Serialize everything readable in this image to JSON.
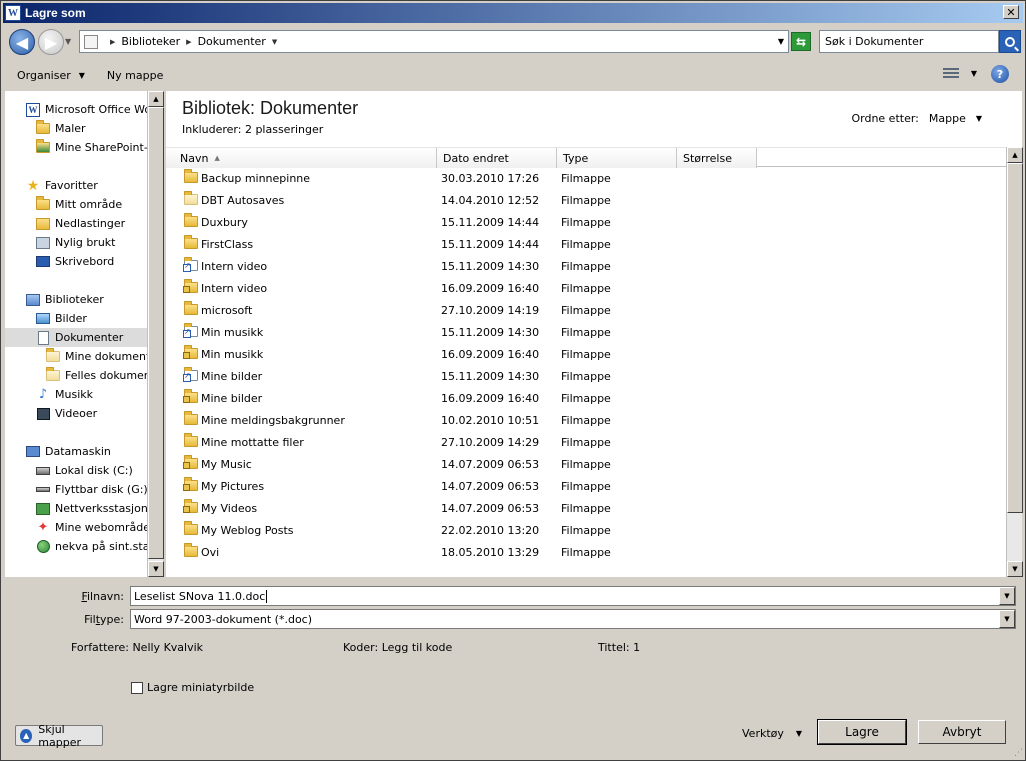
{
  "window": {
    "title": "Lagre som",
    "app_icon_letter": "W",
    "close_glyph": "✕"
  },
  "address": {
    "crumbs": [
      "Biblioteker",
      "Dokumenter"
    ],
    "search_placeholder": "Søk i Dokumenter"
  },
  "toolbar": {
    "organize_label": "Organiser",
    "new_folder_label": "Ny mappe",
    "help_glyph": "?"
  },
  "nav": {
    "items": [
      {
        "label": "Microsoft Office Word",
        "icon": "word-icon"
      },
      {
        "label": "Maler",
        "icon": "folder-icon"
      },
      {
        "label": "Mine SharePoint-om",
        "icon": "sharepoint-folder-icon"
      },
      {
        "label": "Favoritter",
        "icon": "star-icon"
      },
      {
        "label": "Mitt område",
        "icon": "my-site-icon"
      },
      {
        "label": "Nedlastinger",
        "icon": "downloads-icon"
      },
      {
        "label": "Nylig brukt",
        "icon": "recent-icon"
      },
      {
        "label": "Skrivebord",
        "icon": "desktop-icon"
      },
      {
        "label": "Biblioteker",
        "icon": "libraries-icon"
      },
      {
        "label": "Bilder",
        "icon": "pictures-icon"
      },
      {
        "label": "Dokumenter",
        "icon": "documents-icon"
      },
      {
        "label": "Mine dokumenter",
        "icon": "folder-icon"
      },
      {
        "label": "Felles dokumente",
        "icon": "folder-icon"
      },
      {
        "label": "Musikk",
        "icon": "music-icon"
      },
      {
        "label": "Videoer",
        "icon": "videos-icon"
      },
      {
        "label": "Datamaskin",
        "icon": "computer-icon"
      },
      {
        "label": "Lokal disk (C:)",
        "icon": "local-disk-icon"
      },
      {
        "label": "Flyttbar disk (G:)",
        "icon": "removable-disk-icon"
      },
      {
        "label": "Nettverksstasjon (I",
        "icon": "network-drive-icon"
      },
      {
        "label": "Mine webområder p",
        "icon": "web-sites-icon"
      },
      {
        "label": "nekva på sint.statp",
        "icon": "network-location-icon"
      }
    ]
  },
  "content": {
    "title": "Bibliotek: Dokumenter",
    "includes": "Inkluderer:  2 plasseringer",
    "sort_label": "Ordne etter:",
    "sort_value": "Mappe",
    "columns": [
      "Navn",
      "Dato endret",
      "Type",
      "Størrelse"
    ],
    "rows": [
      {
        "name": "Backup minnepinne",
        "date": "30.03.2010 17:26",
        "type": "Filmappe",
        "icon": "folder"
      },
      {
        "name": "DBT Autosaves",
        "date": "14.04.2010 12:52",
        "type": "Filmappe",
        "icon": "folder-pale"
      },
      {
        "name": "Duxbury",
        "date": "15.11.2009 14:44",
        "type": "Filmappe",
        "icon": "folder"
      },
      {
        "name": "FirstClass",
        "date": "15.11.2009 14:44",
        "type": "Filmappe",
        "icon": "folder"
      },
      {
        "name": "Intern video",
        "date": "15.11.2009 14:30",
        "type": "Filmappe",
        "icon": "shortcut"
      },
      {
        "name": "Intern video",
        "date": "16.09.2009 16:40",
        "type": "Filmappe",
        "icon": "folder-locked"
      },
      {
        "name": "microsoft",
        "date": "27.10.2009 14:19",
        "type": "Filmappe",
        "icon": "folder"
      },
      {
        "name": "Min musikk",
        "date": "15.11.2009 14:30",
        "type": "Filmappe",
        "icon": "shortcut"
      },
      {
        "name": "Min musikk",
        "date": "16.09.2009 16:40",
        "type": "Filmappe",
        "icon": "folder-locked"
      },
      {
        "name": "Mine bilder",
        "date": "15.11.2009 14:30",
        "type": "Filmappe",
        "icon": "shortcut"
      },
      {
        "name": "Mine bilder",
        "date": "16.09.2009 16:40",
        "type": "Filmappe",
        "icon": "folder-locked"
      },
      {
        "name": "Mine meldingsbakgrunner",
        "date": "10.02.2010 10:51",
        "type": "Filmappe",
        "icon": "folder"
      },
      {
        "name": "Mine mottatte filer",
        "date": "27.10.2009 14:29",
        "type": "Filmappe",
        "icon": "folder"
      },
      {
        "name": "My Music",
        "date": "14.07.2009 06:53",
        "type": "Filmappe",
        "icon": "folder-locked"
      },
      {
        "name": "My Pictures",
        "date": "14.07.2009 06:53",
        "type": "Filmappe",
        "icon": "folder-locked"
      },
      {
        "name": "My Videos",
        "date": "14.07.2009 06:53",
        "type": "Filmappe",
        "icon": "folder-locked"
      },
      {
        "name": "My Weblog Posts",
        "date": "22.02.2010 13:20",
        "type": "Filmappe",
        "icon": "folder"
      },
      {
        "name": "Ovi",
        "date": "18.05.2010 13:29",
        "type": "Filmappe",
        "icon": "folder"
      }
    ]
  },
  "form": {
    "filename_label_accel": "F",
    "filename_label_rest": "ilnavn:",
    "filename_value": "Leselist SNova 11.0.doc",
    "filetype_label_pre": "Fil",
    "filetype_label_accel": "t",
    "filetype_label_post": "ype:",
    "filetype_value": "Word 97-2003-dokument (*.doc)",
    "authors_label": "Forfattere:",
    "authors_value": "Nelly Kvalvik",
    "tags_label": "Koder:",
    "tags_value": "Legg til kode",
    "title_label": "Tittel:",
    "title_value": "1",
    "thumbnail_label": "Lagre miniatyrbilde"
  },
  "footer": {
    "hide_folders": "Skjul mapper",
    "tools": "Verktøy",
    "save": "Lagre",
    "cancel": "Avbryt"
  }
}
